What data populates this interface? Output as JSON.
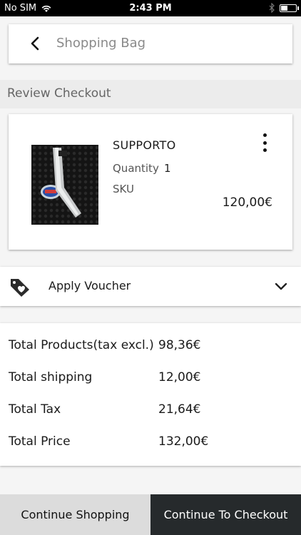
{
  "status_bar": {
    "carrier": "No SIM",
    "time": "2:43 PM",
    "battery_level": 0.4,
    "icons": [
      "wifi-icon",
      "bluetooth-icon",
      "battery-icon"
    ]
  },
  "header": {
    "back_icon": "chevron-left-icon",
    "title": "Shopping Bag"
  },
  "section": {
    "title": "Review Checkout"
  },
  "cart_items": [
    {
      "name": "SUPPORTO",
      "quantity_label": "Quantity",
      "quantity": "1",
      "sku_label": "SKU",
      "price": "120,00€",
      "menu_icon": "more-vertical-icon"
    }
  ],
  "voucher": {
    "icon": "tag-heart-icon",
    "label": "Apply Voucher",
    "expand_icon": "chevron-down-icon"
  },
  "totals": [
    {
      "label": "Total Products(tax excl.)",
      "value": "98,36€"
    },
    {
      "label": "Total shipping",
      "value": "12,00€"
    },
    {
      "label": "Total Tax",
      "value": "21,64€"
    },
    {
      "label": "Total Price",
      "value": "132,00€"
    }
  ],
  "actions": {
    "continue_shopping": "Continue Shopping",
    "continue_checkout": "Continue To Checkout"
  },
  "colors": {
    "checkout_button": "#262a2c",
    "continue_button": "#dcdcdc",
    "page_background": "#f5f5f5"
  }
}
